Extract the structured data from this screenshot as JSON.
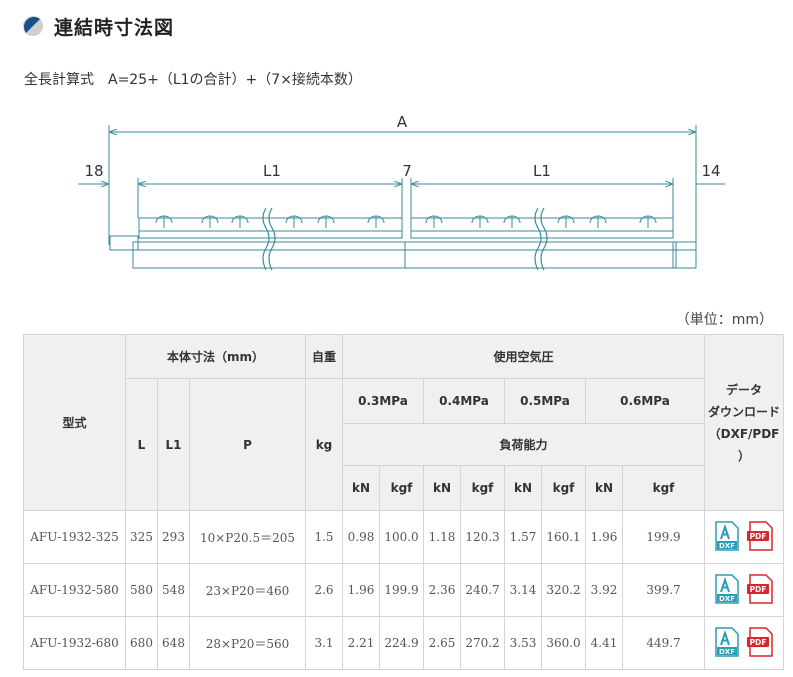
{
  "heading": {
    "title": "連結時寸法図"
  },
  "formula": "全長計算式　A=25+（L1の合計）+（7×接続本数）",
  "drawing": {
    "label_a": "A",
    "label_18": "18",
    "label_l1_left": "L1",
    "label_7": "7",
    "label_l1_right": "L1",
    "label_14": "14"
  },
  "unit_note": "（単位：mm）",
  "table": {
    "h_model": "型式",
    "h_body": "本体寸法（mm）",
    "h_weight": "自重",
    "h_pressure": "使用空気圧",
    "h_download": [
      "データ",
      "ダウンロード",
      "（DXF/PDF",
      "）"
    ],
    "h_l": "L",
    "h_l1": "L1",
    "h_p": "P",
    "h_kg": "kg",
    "h_p03": "0.3MPa",
    "h_p04": "0.4MPa",
    "h_p05": "0.5MPa",
    "h_p06": "0.6MPa",
    "h_load": "負荷能力",
    "h_kn": "kN",
    "h_kgf": "kgf",
    "rows": [
      {
        "model": "AFU-1932-325",
        "l": "325",
        "l1": "293",
        "p": "10×P20.5＝205",
        "kg": "1.5",
        "kn03": "0.98",
        "kgf03": "100.0",
        "kn04": "1.18",
        "kgf04": "120.3",
        "kn05": "1.57",
        "kgf05": "160.1",
        "kn06": "1.96",
        "kgf06": "199.9"
      },
      {
        "model": "AFU-1932-580",
        "l": "580",
        "l1": "548",
        "p": "23×P20＝460",
        "kg": "2.6",
        "kn03": "1.96",
        "kgf03": "199.9",
        "kn04": "2.36",
        "kgf04": "240.7",
        "kn05": "3.14",
        "kgf05": "320.2",
        "kn06": "3.92",
        "kgf06": "399.7"
      },
      {
        "model": "AFU-1932-680",
        "l": "680",
        "l1": "648",
        "p": "28×P20＝560",
        "kg": "3.1",
        "kn03": "2.21",
        "kgf03": "224.9",
        "kn04": "2.65",
        "kgf04": "270.2",
        "kn05": "3.53",
        "kgf05": "360.0",
        "kn06": "4.41",
        "kgf06": "449.7"
      }
    ],
    "dxf_badge": "DXF",
    "pdf_badge": "PDF"
  },
  "colors": {
    "accent": "#1a4f8a",
    "drawing_line": "#3a8a9a",
    "header_bg": "#f0f0f0",
    "pdf_red": "#d8262c",
    "dxf_teal": "#2a9db5"
  }
}
